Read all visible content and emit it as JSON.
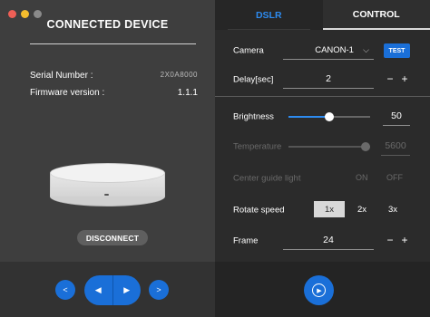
{
  "left_panel": {
    "title": "CONNECTED DEVICE",
    "serial_label": "Serial Number :",
    "serial_value": "2X0A8000",
    "firmware_label": "Firmware version :",
    "firmware_value": "1.1.1",
    "disconnect_label": "DISCONNECT",
    "controls": {
      "prev_icon": "chevron-left-icon",
      "rotate_left_icon": "play-left-icon",
      "rotate_right_icon": "play-right-icon",
      "next_icon": "chevron-right-icon",
      "prev_glyph": "<",
      "rotate_left_glyph": "◀",
      "rotate_right_glyph": "▶",
      "next_glyph": ">"
    }
  },
  "tabs": [
    {
      "label": "DSLR",
      "active": true
    },
    {
      "label": "CONTROL",
      "active": false
    }
  ],
  "settings": {
    "camera_label": "Camera",
    "camera_value": "CANON-1",
    "chevron_glyph": "⌵",
    "test_label": "TEST",
    "delay_label": "Delay[sec]",
    "delay_value": "2",
    "minus_glyph": "−",
    "plus_glyph": "+",
    "brightness_label": "Brightness",
    "brightness_value": "50",
    "brightness_fraction": 0.5,
    "temperature_label": "Temperature",
    "temperature_value": "5600",
    "temperature_fraction": 1.0,
    "guide_label": "Center guide light",
    "guide_on_label": "ON",
    "guide_off_label": "OFF",
    "rotate_label": "Rotate speed",
    "speed_options": [
      "1x",
      "2x",
      "3x"
    ],
    "selected_speed": "1x",
    "frame_label": "Frame",
    "frame_value": "24"
  },
  "play_glyph": "▶",
  "colors": {
    "accent": "#1a6fd8",
    "tab_active": "#2d8bf0",
    "panel_left": "#3e3e3e",
    "panel_right": "#2b2b2b"
  }
}
